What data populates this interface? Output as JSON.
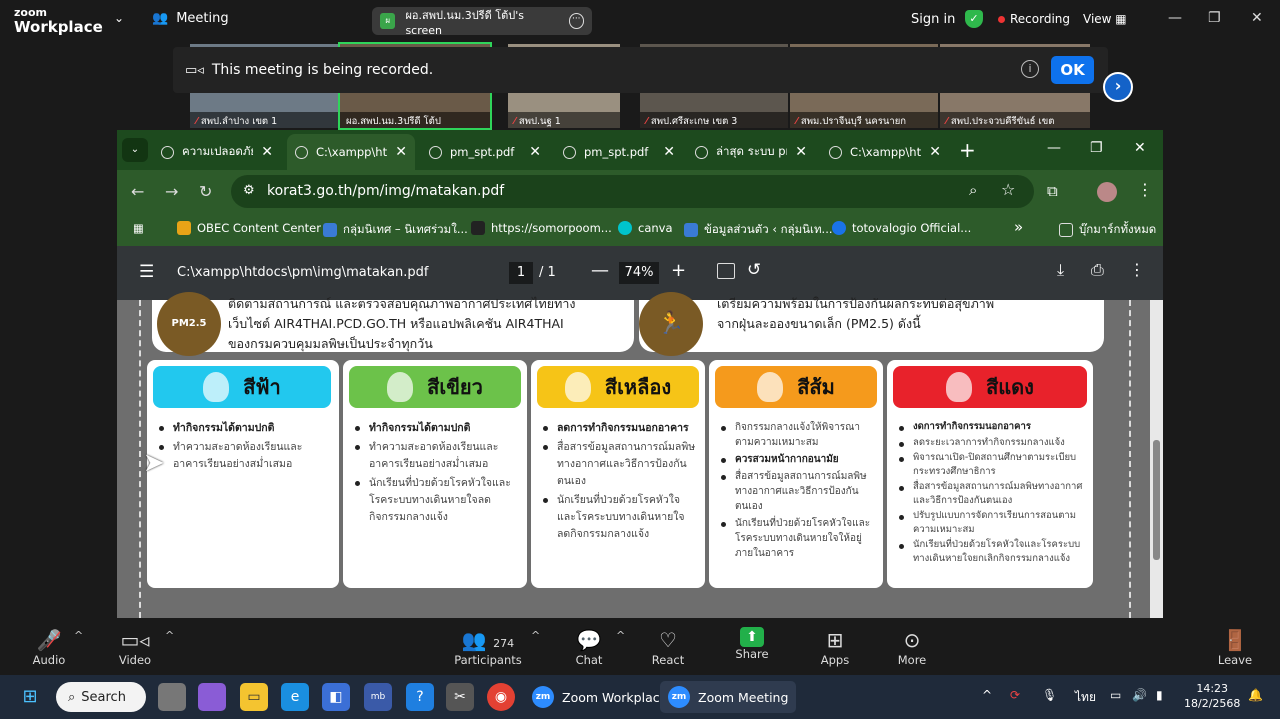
{
  "zoom": {
    "logo_line1": "zoom",
    "logo_line2": "Workplace",
    "chevron": "⌄",
    "meeting_label": "Meeting",
    "share_badge": "ผ",
    "share_title": "ผอ.สพป.นม.3ปรีดี โต้ป's screen",
    "share_more": "···",
    "sign_in": "Sign in",
    "recording": "Recording",
    "view": "View",
    "recorded_msg": "This meeting is being recorded.",
    "info": "i",
    "ok": "OK",
    "next": "›"
  },
  "participants_strip": [
    "สพป.ลำปาง เขต 1",
    "ผอ.สพป.นม.3ปรีดี โต้ป",
    "สพป.นฐ 1",
    "สพป.ศรีสะเกษ เขต 3",
    "สพม.ปราจีนบุรี นครนายก",
    "สพป.ประจวบคีรีขันธ์ เขต"
  ],
  "browser": {
    "tabs": [
      {
        "title": "ความเปลอดภัยใ",
        "active": false
      },
      {
        "title": "C:\\xampp\\ht",
        "active": true
      },
      {
        "title": "pm_spt.pdf",
        "active": false
      },
      {
        "title": "pm_spt.pdf",
        "active": false
      },
      {
        "title": "ล่าสุด ระบบ pr",
        "active": false
      },
      {
        "title": "C:\\xampp\\ht",
        "active": false
      }
    ],
    "url": "korat3.go.th/pm/img/matakan.pdf",
    "bookmarks": [
      {
        "label": "OBEC Content Center",
        "color": "#e8a317"
      },
      {
        "label": "กลุ่มนิเทศ – นิเทศร่วมใ...",
        "color": "#3a7bd5"
      },
      {
        "label": "https://somorpoom...",
        "color": "#222222"
      },
      {
        "label": "canva",
        "color": "#00c4cc"
      },
      {
        "label": "ข้อมูลส่วนตัว ‹ กลุ่มนิเท...",
        "color": "#3a7bd5"
      },
      {
        "label": "totovalogio Official...",
        "color": "#1a73e8"
      }
    ],
    "bookmarks_more": "»",
    "bookmarks_folder": "บุ๊กมาร์กทั้งหมด"
  },
  "pdf": {
    "filename": "C:\\xampp\\htdocs\\pm\\img\\matakan.pdf",
    "page": "1",
    "total": "1",
    "zoom": "74%",
    "top_left_text": [
      "ติดตามสถานการณ์ และตรวจสอบคุณภาพอากาศประเทศไทยทาง",
      "เว็บไซต์ AIR4THAI.PCD.GO.TH หรือแอปพลิเคชัน AIR4THAI",
      "ของกรมควบคุมมลพิษเป็นประจำทุกวัน"
    ],
    "pm_badge": "PM2.5",
    "top_right_text": [
      "เตรียมความพร้อมในการป้องกันผลกระทบต่อสุขภาพ",
      "จากฝุ่นละอองขนาดเล็ก (PM2.5) ดังนี้"
    ],
    "levels": [
      {
        "name": "สีฟ้า",
        "color": "#22c8ee",
        "items": [
          "ทำกิจกรรมได้ตามปกติ",
          "ทำความสะอาดห้องเรียนและอาคารเรียนอย่างสม่ำเสมอ"
        ]
      },
      {
        "name": "สีเขียว",
        "color": "#6cc24a",
        "items": [
          "ทำกิจกรรมได้ตามปกติ",
          "ทำความสะอาดห้องเรียนและอาคารเรียนอย่างสม่ำเสมอ",
          "นักเรียนที่ป่วยด้วยโรคหัวใจและโรคระบบทางเดินหายใจลดกิจกรรมกลางแจ้ง"
        ]
      },
      {
        "name": "สีเหลือง",
        "color": "#f6c417",
        "items": [
          "ลดการทำกิจกรรมนอกอาคาร",
          "สื่อสารข้อมูลสถานการณ์มลพิษทางอากาศและวิธีการป้องกันตนเอง",
          "นักเรียนที่ป่วยด้วยโรคหัวใจและโรคระบบทางเดินหายใจลดกิจกรรมกลางแจ้ง"
        ]
      },
      {
        "name": "สีส้ม",
        "color": "#f59a1c",
        "items": [
          "กิจกรรมกลางแจ้งให้พิจารณาตามความเหมาะสม",
          "ควรสวมหน้ากากอนามัย",
          "สื่อสารข้อมูลสถานการณ์มลพิษทางอากาศและวิธีการป้องกันตนเอง",
          "นักเรียนที่ป่วยด้วยโรคหัวใจและโรคระบบทางเดินหายใจให้อยู่ภายในอาคาร"
        ]
      },
      {
        "name": "สีแดง",
        "color": "#e8222b",
        "items": [
          "งดการทำกิจกรรมนอกอาคาร",
          "ลดระยะเวลาการทำกิจกรรมกลางแจ้ง",
          "พิจารณาเปิด-ปิดสถานศึกษาตามระเบียบกระทรวงศึกษาธิการ",
          "สื่อสารข้อมูลสถานการณ์มลพิษทางอากาศและวิธีการป้องกันตนเอง",
          "ปรับรูปแบบการจัดการเรียนการสอนตามความเหมาะสม",
          "นักเรียนที่ป่วยด้วยโรคหัวใจและโรคระบบทางเดินหายใจยกเลิกกิจกรรมกลางแจ้ง"
        ]
      }
    ]
  },
  "controls": {
    "audio": "Audio",
    "video": "Video",
    "participants": "Participants",
    "participants_count": "274",
    "chat": "Chat",
    "react": "React",
    "share": "Share",
    "apps": "Apps",
    "more": "More",
    "leave": "Leave"
  },
  "taskbar": {
    "search": "Search",
    "app1": "Zoom Workplace",
    "app2": "Zoom Meeting",
    "lang": "ไทย",
    "time": "14:23",
    "date": "18/2/2568"
  }
}
